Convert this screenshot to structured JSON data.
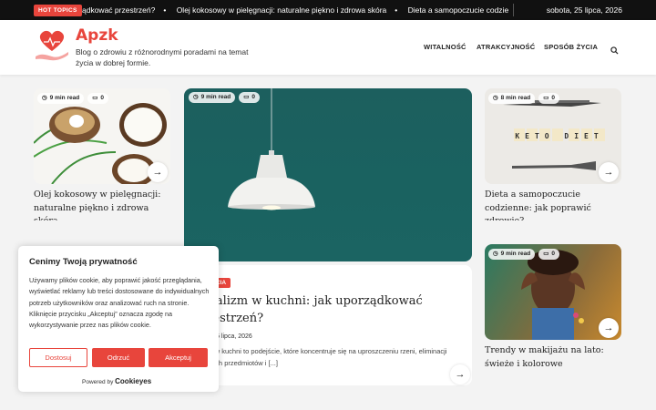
{
  "topbar": {
    "hot_label": "HOT TOPICS",
    "ticker": [
      "ądkować przestrzeń?",
      "Olej kokosowy w pielęgnacji: naturalne piękno i zdrowa skóra",
      "Dieta a samopoczucie codzienne: ja"
    ],
    "date": "sobota, 25 lipca, 2026"
  },
  "header": {
    "site_name": "Apzk",
    "tagline": "Blog o zdrowiu z różnorodnymi poradami na temat życia w dobrej formie.",
    "nav": [
      "WITALNOŚĆ",
      "ATRAKCYJNOŚĆ",
      "SPOSÓB ŻYCIA"
    ],
    "search_icon": "search-icon"
  },
  "cards": [
    {
      "read": "9 min read",
      "comments": "0",
      "title": "Olej kokosowy w pielęgnacji: naturalne piękno i zdrowa skóra"
    },
    {
      "read": "8 min read",
      "comments": "0",
      "title": "Dieta a samopoczucie codzienne: jak poprawić zdrowie?",
      "img_text": "KETO DIET"
    },
    {
      "read": "9 min read",
      "comments": "0",
      "title": "Trendy w makijażu na lato: świeże i kolorowe"
    }
  ],
  "featured": {
    "read": "9 min read",
    "comments": "0",
    "category": "SPOSÓB ŻYCIA",
    "category_visible": "ÓB ŻYCIA",
    "title": "nimalizm w kuchni: jak uporządkować przestrzeń?",
    "author_fragment": "K",
    "date": "25 lipca, 2026",
    "excerpt": "nalizm w kuchni to podejście, które koncentruje się na uproszczeniu rzeni, eliminacji zbędnych przedmiotów i [...]"
  },
  "cookie": {
    "heading": "Cenimy Twoją prywatność",
    "text": "Używamy plików cookie, aby poprawić jakość przeglądania, wyświetlać reklamy lub treści dostosowane do indywidualnych potrzeb użytkowników oraz analizować ruch na stronie. Kliknięcie przycisku „Akceptuj” oznacza zgodę na wykorzystywanie przez nas plików cookie.",
    "customize": "Dostosuj",
    "reject": "Odrzuć",
    "accept": "Akceptuj",
    "powered": "Powered by",
    "brand": "Cookieyes"
  },
  "colors": {
    "accent": "#e8453c",
    "topbar": "#111111"
  }
}
